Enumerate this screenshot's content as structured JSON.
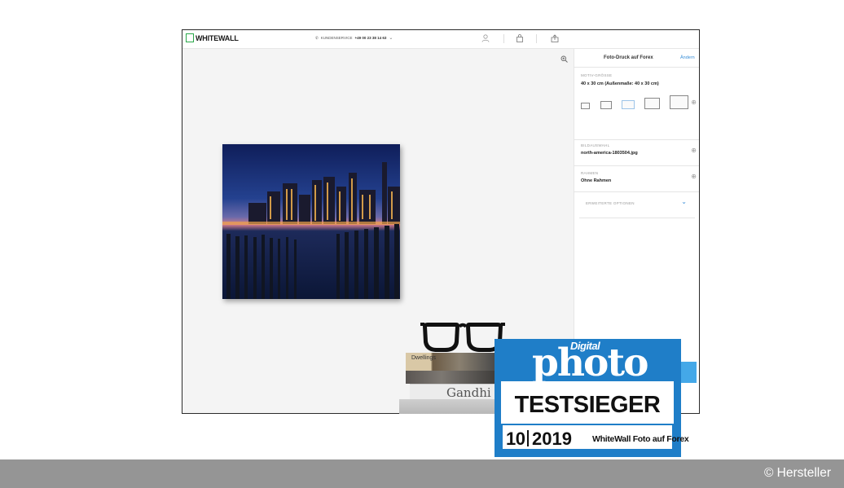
{
  "app": {
    "logo_text": "WHITEWALL",
    "hotline_label": "KUNDENSERVICE",
    "hotline_number": "+49 00 23 38 14 63",
    "hotline_chevron": "⌄"
  },
  "toolbar": {
    "icons": [
      "user-icon",
      "bag-icon",
      "upload-icon"
    ]
  },
  "panel": {
    "title": "Foto-Druck auf Forex",
    "change_link": "Ändern",
    "sections": [
      {
        "label": "MOTIV-GRÖSSE",
        "value": "40 x 30 cm (Außenmaße: 40 x 30 cm)"
      },
      {
        "label": "BILDAUSWAHL",
        "value": "north-america-1803504.jpg"
      },
      {
        "label": "RAHMEN",
        "value": "Ohne Rahmen"
      }
    ],
    "advanced_label": "ERWEITERTE OPTIONEN",
    "size_options_count": 5,
    "selected_size_index": 2
  },
  "decor": {
    "book_spine_title": "Gandhi",
    "book_top_title": "Dwellings"
  },
  "badge": {
    "brand_small": "Digital",
    "brand_large": "photo",
    "award": "TESTSIEGER",
    "issue": "10",
    "year": "2019",
    "product": "WhiteWall Foto auf Forex",
    "color": "#1f7ec8"
  },
  "footer": {
    "credit": "© Hersteller"
  }
}
